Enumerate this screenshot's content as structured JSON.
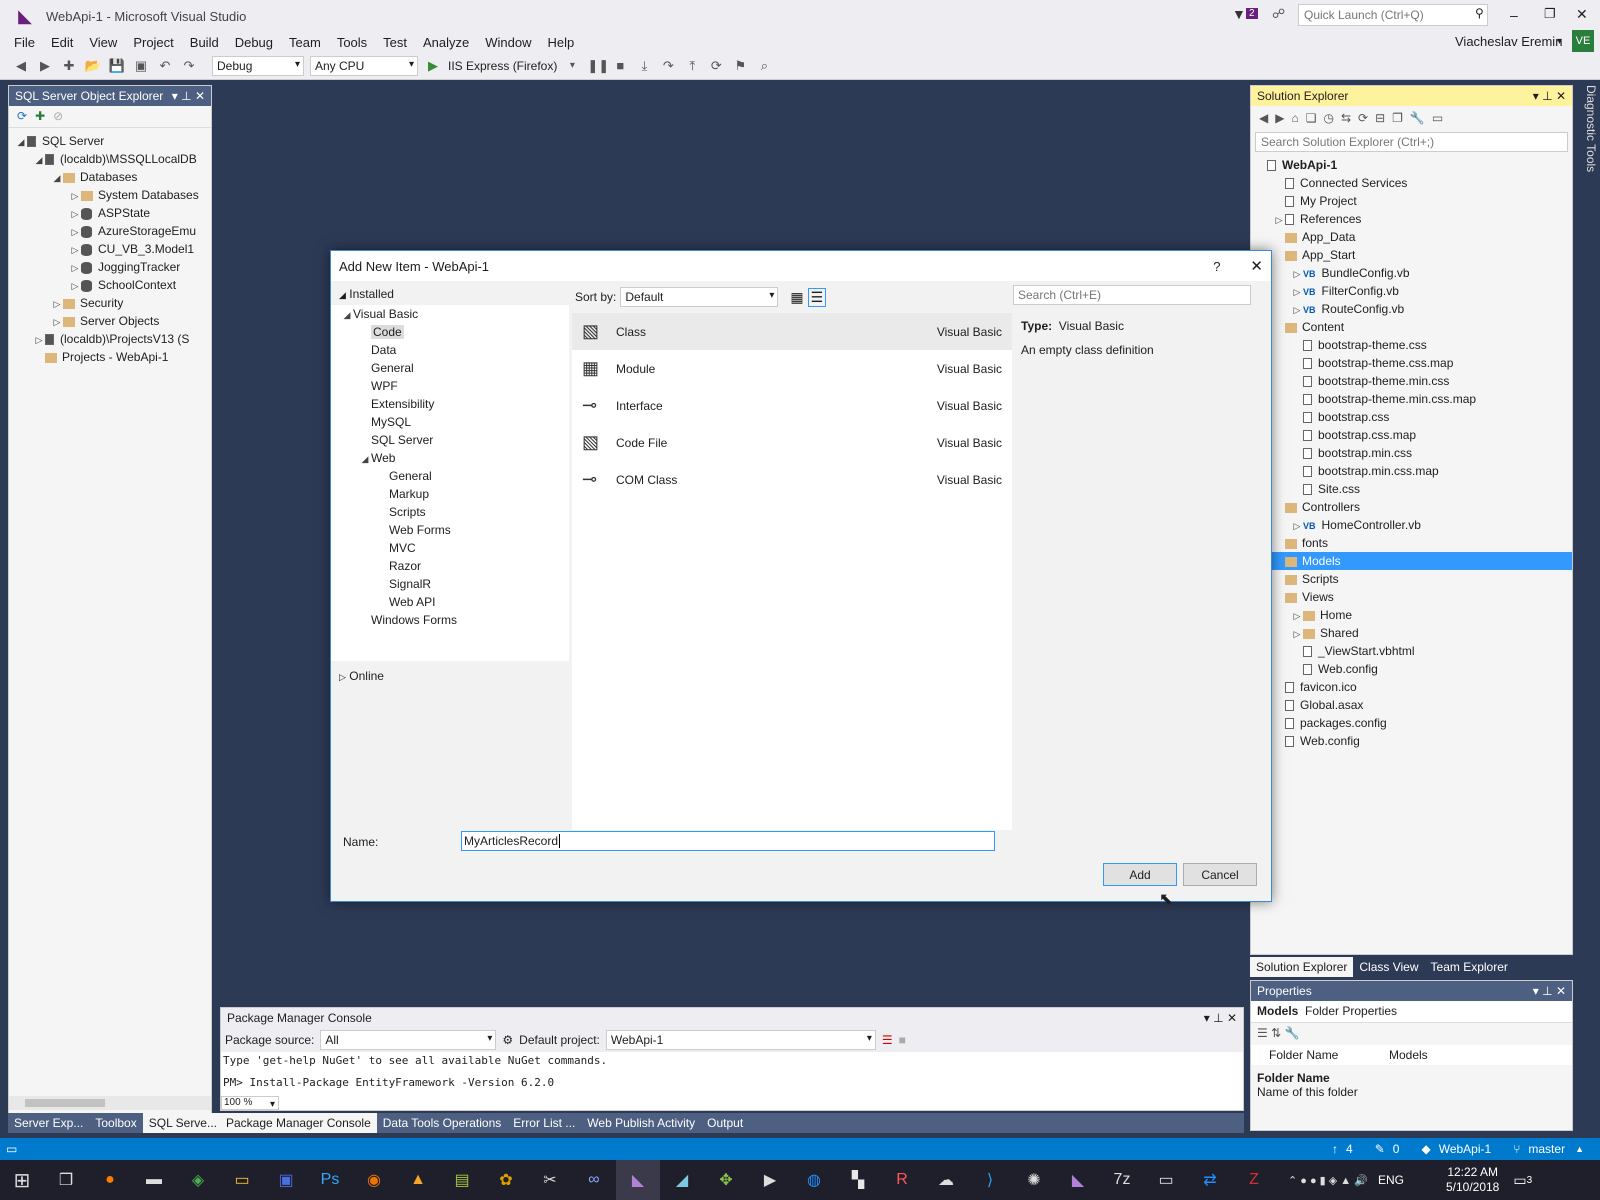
{
  "window": {
    "title": "WebApi-1 - Microsoft Visual Studio",
    "quick_launch_placeholder": "Quick Launch (Ctrl+Q)",
    "notification_count": "2",
    "user": "Viacheslav Eremin",
    "user_initials": "VE"
  },
  "menu": [
    "File",
    "Edit",
    "View",
    "Project",
    "Build",
    "Debug",
    "Team",
    "Tools",
    "Test",
    "Analyze",
    "Window",
    "Help"
  ],
  "toolbar": {
    "config": "Debug",
    "platform": "Any CPU",
    "run_target": "IIS Express (Firefox)"
  },
  "sql_explorer": {
    "title": "SQL Server Object Explorer",
    "items": [
      {
        "label": "SQL Server",
        "indent": 0,
        "icon": "server",
        "arrow": "open"
      },
      {
        "label": "(localdb)\\MSSQLLocalDB",
        "indent": 1,
        "icon": "server",
        "arrow": "open"
      },
      {
        "label": "Databases",
        "indent": 2,
        "icon": "folder",
        "arrow": "open"
      },
      {
        "label": "System Databases",
        "indent": 3,
        "icon": "folder",
        "arrow": "closed"
      },
      {
        "label": "ASPState",
        "indent": 3,
        "icon": "db",
        "arrow": "closed"
      },
      {
        "label": "AzureStorageEmu",
        "indent": 3,
        "icon": "db",
        "arrow": "closed"
      },
      {
        "label": "CU_VB_3.Model1",
        "indent": 3,
        "icon": "db",
        "arrow": "closed"
      },
      {
        "label": "JoggingTracker",
        "indent": 3,
        "icon": "db",
        "arrow": "closed"
      },
      {
        "label": "SchoolContext",
        "indent": 3,
        "icon": "db",
        "arrow": "closed"
      },
      {
        "label": "Security",
        "indent": 2,
        "icon": "folder",
        "arrow": "closed"
      },
      {
        "label": "Server Objects",
        "indent": 2,
        "icon": "folder",
        "arrow": "closed"
      },
      {
        "label": "(localdb)\\ProjectsV13 (S",
        "indent": 1,
        "icon": "server",
        "arrow": "closed"
      },
      {
        "label": "Projects - WebApi-1",
        "indent": 1,
        "icon": "folder",
        "arrow": "none"
      }
    ],
    "tabs": [
      "Server Exp...",
      "Toolbox",
      "SQL Serve..."
    ]
  },
  "dialog": {
    "title": "Add New Item - WebApi-1",
    "help": "?",
    "installed": "Installed",
    "tree": [
      {
        "label": "Visual Basic",
        "indent": 0,
        "arrow": "open"
      },
      {
        "label": "Code",
        "indent": 1,
        "selected": true
      },
      {
        "label": "Data",
        "indent": 1
      },
      {
        "label": "General",
        "indent": 1
      },
      {
        "label": "WPF",
        "indent": 1
      },
      {
        "label": "Extensibility",
        "indent": 1
      },
      {
        "label": "MySQL",
        "indent": 1
      },
      {
        "label": "SQL Server",
        "indent": 1
      },
      {
        "label": "Web",
        "indent": 1,
        "arrow": "open"
      },
      {
        "label": "General",
        "indent": 2
      },
      {
        "label": "Markup",
        "indent": 2
      },
      {
        "label": "Scripts",
        "indent": 2
      },
      {
        "label": "Web Forms",
        "indent": 2
      },
      {
        "label": "MVC",
        "indent": 2
      },
      {
        "label": "Razor",
        "indent": 2
      },
      {
        "label": "SignalR",
        "indent": 2
      },
      {
        "label": "Web API",
        "indent": 2
      },
      {
        "label": "Windows Forms",
        "indent": 1
      }
    ],
    "online": "Online",
    "sort_label": "Sort by:",
    "sort_value": "Default",
    "search_placeholder": "Search (Ctrl+E)",
    "templates": [
      {
        "name": "Class",
        "lang": "Visual Basic",
        "icon": "class-icon"
      },
      {
        "name": "Module",
        "lang": "Visual Basic",
        "icon": "module-icon"
      },
      {
        "name": "Interface",
        "lang": "Visual Basic",
        "icon": "interface-icon"
      },
      {
        "name": "Code File",
        "lang": "Visual Basic",
        "icon": "code-file-icon"
      },
      {
        "name": "COM Class",
        "lang": "Visual Basic",
        "icon": "com-class-icon"
      }
    ],
    "type_label": "Type:",
    "type_value": "Visual Basic",
    "description": "An empty class definition",
    "name_label": "Name:",
    "name_value": "MyArticlesRecord",
    "add": "Add",
    "cancel": "Cancel"
  },
  "solution_explorer": {
    "title": "Solution Explorer",
    "search_placeholder": "Search Solution Explorer (Ctrl+;)",
    "items": [
      {
        "label": "WebApi-1",
        "indent": 0,
        "icon": "project",
        "bold": true
      },
      {
        "label": "Connected Services",
        "indent": 1,
        "icon": "file"
      },
      {
        "label": "My Project",
        "indent": 1,
        "icon": "file"
      },
      {
        "label": "References",
        "indent": 1,
        "icon": "file",
        "arrow": "closed"
      },
      {
        "label": "App_Data",
        "indent": 1,
        "icon": "folder"
      },
      {
        "label": "App_Start",
        "indent": 1,
        "icon": "folder"
      },
      {
        "label": "BundleConfig.vb",
        "indent": 2,
        "icon": "vb",
        "arrow": "closed"
      },
      {
        "label": "FilterConfig.vb",
        "indent": 2,
        "icon": "vb",
        "arrow": "closed"
      },
      {
        "label": "RouteConfig.vb",
        "indent": 2,
        "icon": "vb",
        "arrow": "closed"
      },
      {
        "label": "Content",
        "indent": 1,
        "icon": "folder"
      },
      {
        "label": "bootstrap-theme.css",
        "indent": 2,
        "icon": "file"
      },
      {
        "label": "bootstrap-theme.css.map",
        "indent": 2,
        "icon": "file"
      },
      {
        "label": "bootstrap-theme.min.css",
        "indent": 2,
        "icon": "file"
      },
      {
        "label": "bootstrap-theme.min.css.map",
        "indent": 2,
        "icon": "file"
      },
      {
        "label": "bootstrap.css",
        "indent": 2,
        "icon": "file"
      },
      {
        "label": "bootstrap.css.map",
        "indent": 2,
        "icon": "file"
      },
      {
        "label": "bootstrap.min.css",
        "indent": 2,
        "icon": "file"
      },
      {
        "label": "bootstrap.min.css.map",
        "indent": 2,
        "icon": "file"
      },
      {
        "label": "Site.css",
        "indent": 2,
        "icon": "file"
      },
      {
        "label": "Controllers",
        "indent": 1,
        "icon": "folder"
      },
      {
        "label": "HomeController.vb",
        "indent": 2,
        "icon": "vb",
        "arrow": "closed"
      },
      {
        "label": "fonts",
        "indent": 1,
        "icon": "folder"
      },
      {
        "label": "Models",
        "indent": 1,
        "icon": "folder",
        "selected": true
      },
      {
        "label": "Scripts",
        "indent": 1,
        "icon": "folder"
      },
      {
        "label": "Views",
        "indent": 1,
        "icon": "folder"
      },
      {
        "label": "Home",
        "indent": 2,
        "icon": "folder",
        "arrow": "closed"
      },
      {
        "label": "Shared",
        "indent": 2,
        "icon": "folder",
        "arrow": "closed"
      },
      {
        "label": "_ViewStart.vbhtml",
        "indent": 2,
        "icon": "file"
      },
      {
        "label": "Web.config",
        "indent": 2,
        "icon": "file"
      },
      {
        "label": "favicon.ico",
        "indent": 1,
        "icon": "file"
      },
      {
        "label": "Global.asax",
        "indent": 1,
        "icon": "file"
      },
      {
        "label": "packages.config",
        "indent": 1,
        "icon": "file"
      },
      {
        "label": "Web.config",
        "indent": 1,
        "icon": "file"
      }
    ],
    "tabs": [
      "Solution Explorer",
      "Class View",
      "Team Explorer"
    ]
  },
  "diagnostic_tools": "Diagnostic Tools",
  "properties": {
    "title": "Properties",
    "object": "Models",
    "object_type": "Folder Properties",
    "row_name": "Folder Name",
    "row_value": "Models",
    "desc_title": "Folder Name",
    "desc_text": "Name of this folder"
  },
  "pmc": {
    "title": "Package Manager Console",
    "source_label": "Package source:",
    "source_value": "All",
    "project_label": "Default project:",
    "project_value": "WebApi-1",
    "line1": "Type 'get-help NuGet' to see all available NuGet commands.",
    "line2": "PM> Install-Package EntityFramework -Version 6.2.0",
    "zoom": "100 %",
    "tabs": [
      "Package Manager Console",
      "Data Tools Operations",
      "Error List ...",
      "Web Publish Activity",
      "Output"
    ]
  },
  "status": {
    "commits": "4",
    "changes": "0",
    "project": "WebApi-1",
    "branch": "master"
  },
  "taskbar": {
    "lang": "ENG",
    "time": "12:22 AM",
    "date": "5/10/2018",
    "notif": "3"
  }
}
